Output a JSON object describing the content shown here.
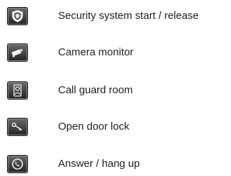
{
  "legend": {
    "items": [
      {
        "icon": "shield-icon",
        "label": "Security system start / release"
      },
      {
        "icon": "camera-icon",
        "label": "Camera monitor"
      },
      {
        "icon": "guard-icon",
        "label": "Call guard room"
      },
      {
        "icon": "key-icon",
        "label": "Open door lock"
      },
      {
        "icon": "phone-icon",
        "label": "Answer / hang up"
      }
    ]
  }
}
